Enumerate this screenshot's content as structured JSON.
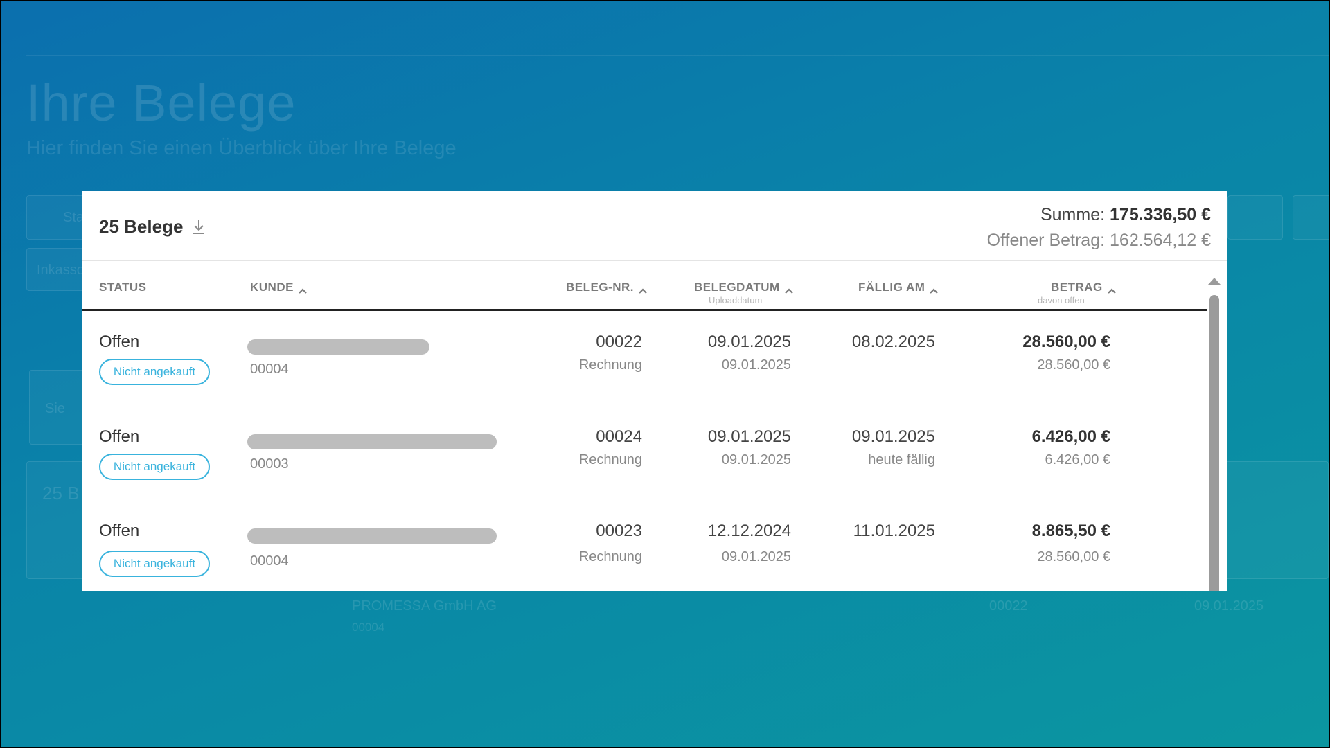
{
  "background": {
    "title": "Ihre Belege",
    "subtitle": "Hier finden Sie einen Überblick über Ihre Belege",
    "stat_filter": "Sta",
    "inkasso_filter": "Inkasso",
    "hint": "Sie",
    "count_label": "25 B",
    "company": "PROMESSA GmbH AG",
    "company_sub": "00004",
    "nr": "00022",
    "date": "09.01.2025"
  },
  "summary": {
    "count_label": "25 Belege",
    "sum_label": "Summe:",
    "sum_value": "175.336,50 €",
    "open_label": "Offener Betrag:",
    "open_value": "162.564,12 €"
  },
  "columns": {
    "status": "STATUS",
    "kunde": "KUNDE",
    "beleg_nr": "BELEG-NR.",
    "belegdatum": "BELEGDATUM",
    "belegdatum_sub": "Uploaddatum",
    "faellig": "FÄLLIG AM",
    "betrag": "BETRAG",
    "betrag_sub": "davon offen"
  },
  "rows": [
    {
      "status": "Offen",
      "badge": "Nicht angekauft",
      "redact_fraction": 0.73,
      "kunde_nr": "00004",
      "beleg_nr": "00022",
      "beleg_typ": "Rechnung",
      "belegdatum": "09.01.2025",
      "uploaddatum": "09.01.2025",
      "faellig": "08.02.2025",
      "faellig_sub": "",
      "betrag": "28.560,00 €",
      "offen": "28.560,00 €"
    },
    {
      "status": "Offen",
      "badge": "Nicht angekauft",
      "redact_fraction": 1.0,
      "kunde_nr": "00003",
      "beleg_nr": "00024",
      "beleg_typ": "Rechnung",
      "belegdatum": "09.01.2025",
      "uploaddatum": "09.01.2025",
      "faellig": "09.01.2025",
      "faellig_sub": "heute fällig",
      "betrag": "6.426,00 €",
      "offen": "6.426,00 €"
    },
    {
      "status": "Offen",
      "badge": "Nicht angekauft",
      "redact_fraction": 1.0,
      "kunde_nr": "00004",
      "beleg_nr": "00023",
      "beleg_typ": "Rechnung",
      "belegdatum": "12.12.2024",
      "uploaddatum": "09.01.2025",
      "faellig": "11.01.2025",
      "faellig_sub": "",
      "betrag": "8.865,50 €",
      "offen": "28.560,00 €"
    }
  ],
  "icons": {
    "download": "download-icon",
    "sort": "chevron-up-icon",
    "scroll_up": "triangle-up-icon"
  },
  "colors": {
    "accent": "#39b3dd",
    "redaction": "#bdbdbd",
    "scrollbar": "#9b9b9b"
  }
}
